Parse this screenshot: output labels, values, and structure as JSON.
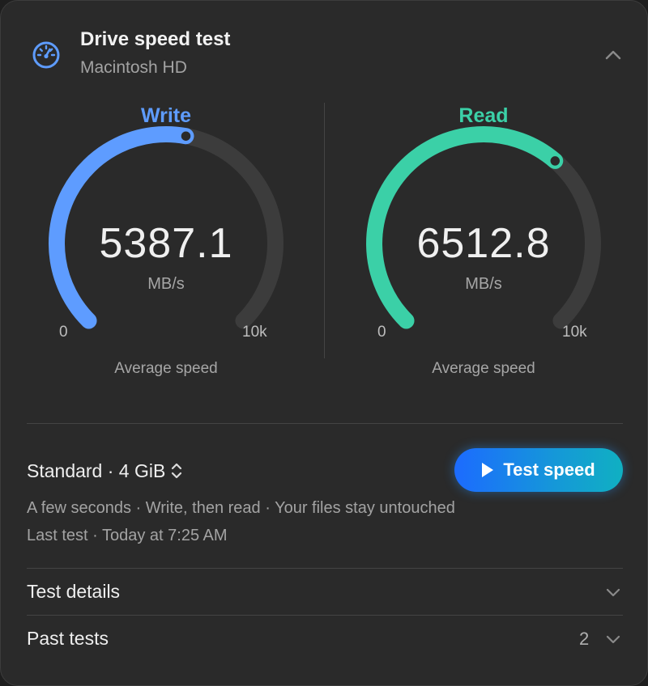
{
  "header": {
    "title": "Drive speed test",
    "subtitle": "Macintosh HD",
    "icon": "speedometer-icon",
    "collapse_icon": "chevron-up-icon"
  },
  "gauges": {
    "write": {
      "label": "Write",
      "value": "5387.1",
      "unit": "MB/s",
      "min_label": "0",
      "max_label": "10k",
      "fraction": 0.53871,
      "caption": "Average speed",
      "color": "#5e9cff"
    },
    "read": {
      "label": "Read",
      "value": "6512.8",
      "unit": "MB/s",
      "min_label": "0",
      "max_label": "10k",
      "fraction": 0.65128,
      "caption": "Average speed",
      "color": "#3bd0a7"
    }
  },
  "controls": {
    "mode_label": "Standard · 4 GiB",
    "mode_icon": "up-down-chevron-icon",
    "test_button_label": "Test speed",
    "test_button_icon": "play-icon",
    "description": "A few seconds · Write, then read · Your files stay untouched",
    "last_test": "Last test · Today at 7:25 AM"
  },
  "sections": {
    "details_label": "Test details",
    "past_label": "Past tests",
    "past_count": "2",
    "expand_icon": "chevron-down-icon"
  },
  "colors": {
    "panel_bg": "#2a2a2a",
    "track": "#3c3c3c",
    "accent_blue": "#1c6bff",
    "accent_teal": "#10b0c2"
  }
}
